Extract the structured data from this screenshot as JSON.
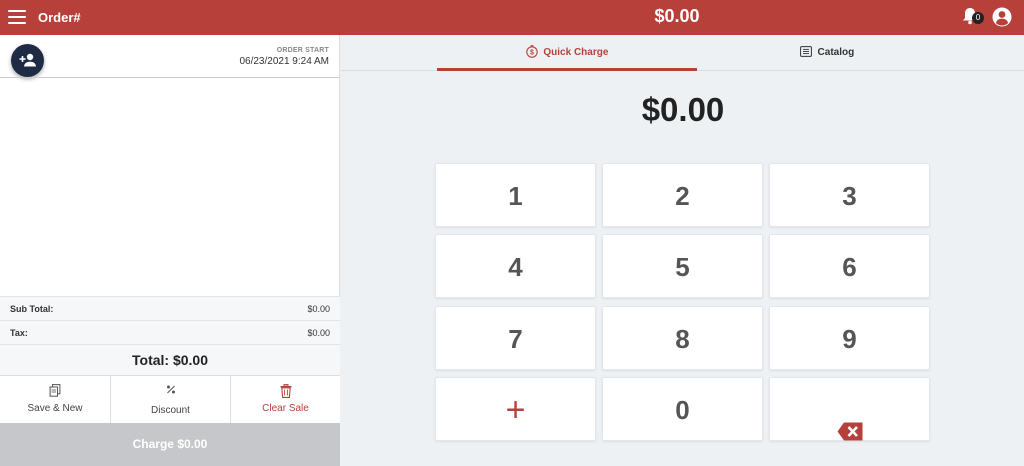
{
  "header": {
    "order_label": "Order#",
    "amount": "$0.00",
    "notification_count": "0",
    "menu_icon": "hamburger-menu-icon",
    "bell_icon": "bell-icon",
    "user_icon": "account-circle-icon",
    "brand_color": "#b8403a"
  },
  "order_panel": {
    "add_customer_icon": "add-person-icon",
    "order_start_label": "ORDER START",
    "order_start_date": "06/23/2021 9:24 AM",
    "subtotal_label": "Sub Total:",
    "subtotal_value": "$0.00",
    "tax_label": "Tax:",
    "tax_value": "$0.00",
    "total_text": "Total: $0.00",
    "actions": [
      {
        "label": "Save & New",
        "icon": "document-copy-icon"
      },
      {
        "label": "Discount",
        "icon": "percent-icon"
      },
      {
        "label": "Clear Sale",
        "icon": "trash-icon"
      }
    ],
    "charge_label": "Charge $0.00"
  },
  "tabs": [
    {
      "label": "Quick Charge",
      "icon": "dollar-timer-icon",
      "active": true
    },
    {
      "label": "Catalog",
      "icon": "catalog-list-icon",
      "active": false
    }
  ],
  "keypad": {
    "amount": "$0.00",
    "keys": [
      "1",
      "2",
      "3",
      "4",
      "5",
      "6",
      "7",
      "8",
      "9",
      "+",
      "0",
      "backspace"
    ],
    "backspace_icon": "backspace-icon"
  }
}
